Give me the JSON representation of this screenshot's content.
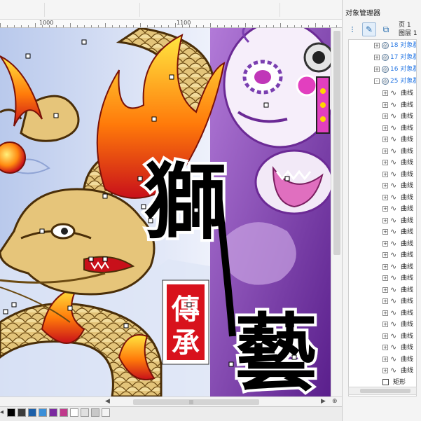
{
  "ruler": {
    "labels": [
      "1000",
      "1100"
    ]
  },
  "artwork": {
    "calligraphy_main": [
      "獅",
      "藝"
    ],
    "seal_text": [
      "傳",
      "承"
    ]
  },
  "panel": {
    "title": "对象管理器",
    "page_label": "页 1",
    "layer_label": "图层 1",
    "tree": {
      "groups": [
        {
          "toggle": "+",
          "label": "18 对象群组"
        },
        {
          "toggle": "+",
          "label": "17 对象群组"
        },
        {
          "toggle": "+",
          "label": "16 对象群组"
        },
        {
          "toggle": "-",
          "label": "25 对象群组"
        }
      ],
      "curve_label": "曲线",
      "curve_count": 25,
      "rect_label": "矩形"
    }
  },
  "palette": {
    "colors": [
      "#000000",
      "#3b3b3b",
      "#1c5fa8",
      "#3b8fd8",
      "#7b2aa0",
      "#c03a8c",
      "#ffffff",
      "#e0e0e0",
      "#c8c8c8",
      "#f4f4f4"
    ]
  },
  "colors": {
    "accent": "#2c7be5",
    "dragon_gold": "#e6c57a",
    "lion_purple": "#7a3fb0",
    "seal_red": "#d8121c"
  }
}
